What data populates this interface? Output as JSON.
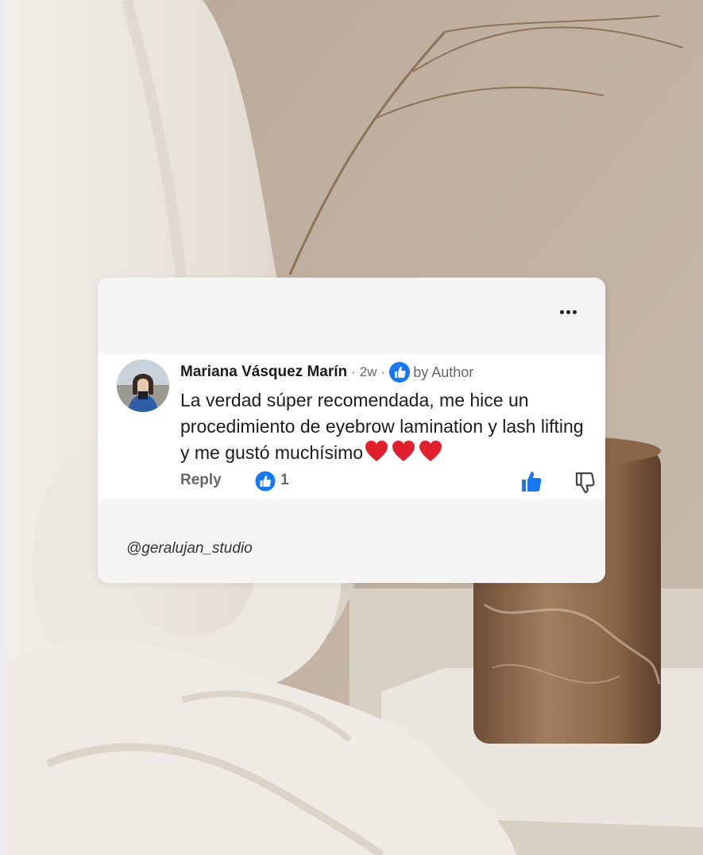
{
  "comment": {
    "author": "Mariana Vásquez Marín",
    "age": "2w",
    "separator": "·",
    "author_badge": "by Author",
    "text": "La verdad súper recomendada, me hice un procedimiento de eyebrow lamination y lash lifting y me gustó muchísimo",
    "reply_label": "Reply",
    "like_count": "1"
  },
  "footer": {
    "handle": "@geralujan_studio"
  },
  "icons": [
    "more-options-icon",
    "like-badge-icon",
    "heart-icon",
    "like-reaction-icon",
    "thumbs-up-icon",
    "thumbs-down-icon"
  ],
  "colors": {
    "like_blue": "#1877f2",
    "heart_red": "#e0202c",
    "meta_gray": "#65676b",
    "text": "#1c1c1c"
  }
}
